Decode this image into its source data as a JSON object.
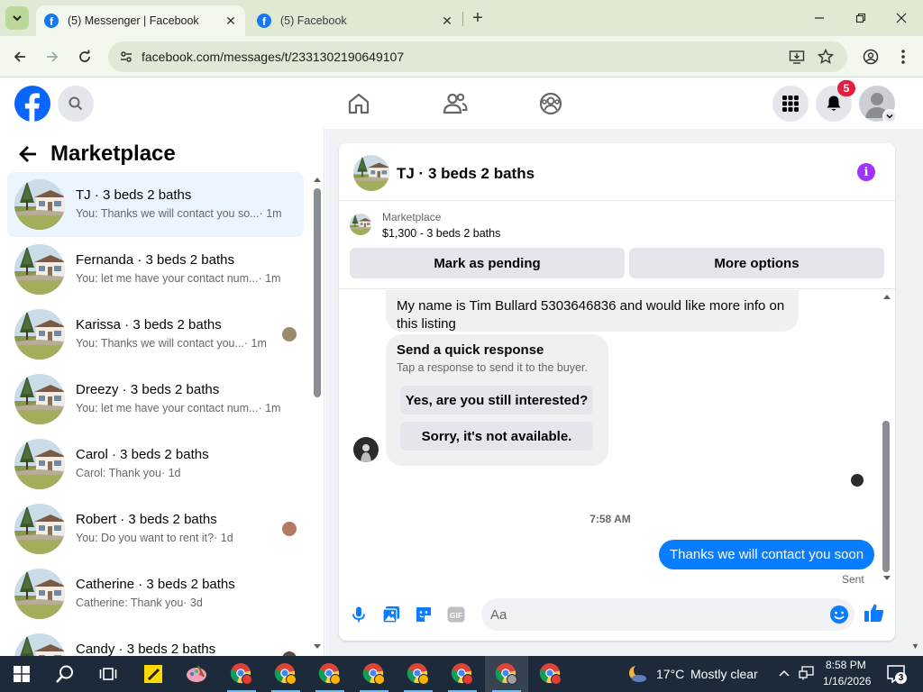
{
  "browser": {
    "tabs": [
      {
        "title": "(5) Messenger | Facebook",
        "active": true
      },
      {
        "title": "(5) Facebook",
        "active": false
      }
    ],
    "url": "facebook.com/messages/t/2331302190649107"
  },
  "fb": {
    "notifications_count": "5",
    "accent": "#1877f2"
  },
  "sidebar": {
    "title": "Marketplace",
    "conversations": [
      {
        "name": "TJ · 3 beds 2 baths",
        "snippet": "You: Thanks we will contact you so...",
        "time": "· 1m",
        "selected": true
      },
      {
        "name": "Fernanda · 3 beds 2 baths",
        "snippet": "You: let me have your contact num...",
        "time": "· 1m"
      },
      {
        "name": "Karissa · 3 beds 2 baths",
        "snippet": "You: Thanks we will contact you...",
        "time": "· 1m"
      },
      {
        "name": "Dreezy · 3 beds 2 baths",
        "snippet": "You: let me have your contact num...",
        "time": "· 1m"
      },
      {
        "name": "Carol · 3 beds 2 baths",
        "snippet": "Carol: Thank you",
        "time": "· 1d"
      },
      {
        "name": "Robert · 3 beds 2 baths",
        "snippet": "You: Do you want to rent it?",
        "time": "· 1d"
      },
      {
        "name": "Catherine · 3 beds 2 baths",
        "snippet": "Catherine: Thank you",
        "time": "· 3d"
      },
      {
        "name": "Candy · 3 beds 2 baths",
        "snippet": "",
        "time": ""
      }
    ]
  },
  "chat": {
    "title": "TJ · 3 beds 2 baths",
    "listing": {
      "category": "Marketplace",
      "price_line": "$1,300 - 3 beds 2 baths",
      "mark_pending_label": "Mark as pending",
      "more_options_label": "More options"
    },
    "messages": {
      "incoming_text": "My name is Tim Bullard 5303646836 and would like more info on this listing",
      "quick_response_title": "Send a quick response",
      "quick_response_sub": "Tap a response to send it to the buyer.",
      "quick_responses": [
        "Yes, are you still interested?",
        "Sorry, it's not available."
      ],
      "timestamp": "7:58 AM",
      "outgoing_text": "Thanks we will contact you soon",
      "status": "Sent"
    },
    "composer": {
      "placeholder": "Aa"
    }
  },
  "taskbar": {
    "weather_temp": "17°C",
    "weather_desc": "Mostly clear",
    "time": "8:58 PM",
    "date": "1/16/2026",
    "notification_count": "3"
  }
}
